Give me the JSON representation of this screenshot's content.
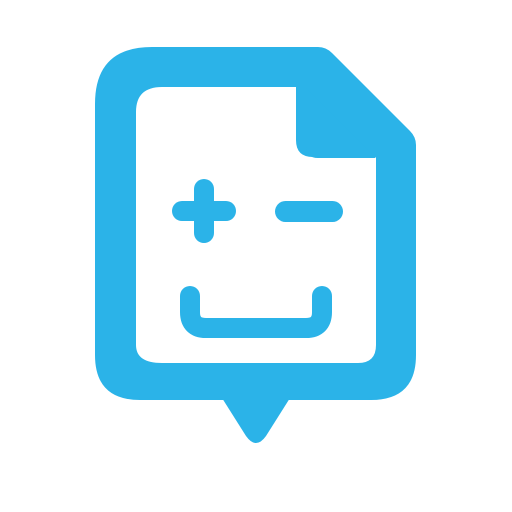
{
  "icon": {
    "name": "document-smiley-chat-icon",
    "colors": {
      "accent": "#2BB3E8",
      "background": "#FFFFFF"
    },
    "parts": [
      "document-outline",
      "folded-corner",
      "speech-bubble-tail",
      "plus-sign",
      "minus-sign",
      "smile-mouth"
    ]
  }
}
